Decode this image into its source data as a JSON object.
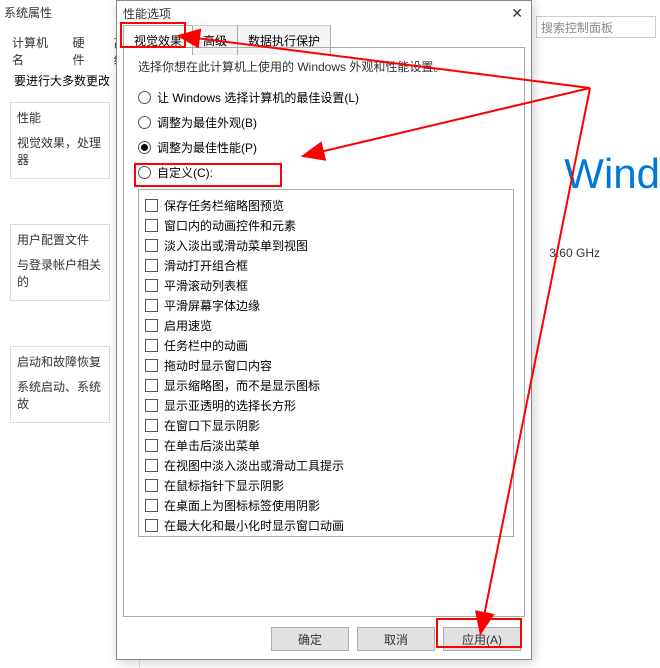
{
  "bg": {
    "title": "系统属性",
    "tabs": [
      "计算机名",
      "硬件",
      "高级"
    ],
    "note": "要进行大多数更改",
    "sections": [
      {
        "title": "性能",
        "text": "视觉效果，处理器"
      },
      {
        "title": "用户配置文件",
        "text": "与登录帐户相关的"
      },
      {
        "title": "启动和故障恢复",
        "text": "系统启动、系统故"
      }
    ]
  },
  "right": {
    "search_placeholder": "搜索控制面板",
    "brand": "Wind",
    "ghz": "3.60 GHz"
  },
  "dialog": {
    "title": "性能选项",
    "tabs": {
      "t1": "视觉效果",
      "t2": "高级",
      "t3": "数据执行保护"
    },
    "intro": "选择你想在此计算机上使用的 Windows 外观和性能设置。",
    "radios": {
      "r1": "让 Windows 选择计算机的最佳设置(L)",
      "r2": "调整为最佳外观(B)",
      "r3": "调整为最佳性能(P)",
      "r4": "自定义(C):"
    },
    "checks": [
      "保存任务栏缩略图预览",
      "窗口内的动画控件和元素",
      "淡入淡出或滑动菜单到视图",
      "滑动打开组合框",
      "平滑滚动列表框",
      "平滑屏幕字体边缘",
      "启用速览",
      "任务栏中的动画",
      "拖动时显示窗口内容",
      "显示缩略图，而不是显示图标",
      "显示亚透明的选择长方形",
      "在窗口下显示阴影",
      "在单击后淡出菜单",
      "在视图中淡入淡出或滑动工具提示",
      "在鼠标指针下显示阴影",
      "在桌面上为图标标签使用阴影",
      "在最大化和最小化时显示窗口动画"
    ],
    "buttons": {
      "ok": "确定",
      "cancel": "取消",
      "apply": "应用(A)"
    }
  }
}
